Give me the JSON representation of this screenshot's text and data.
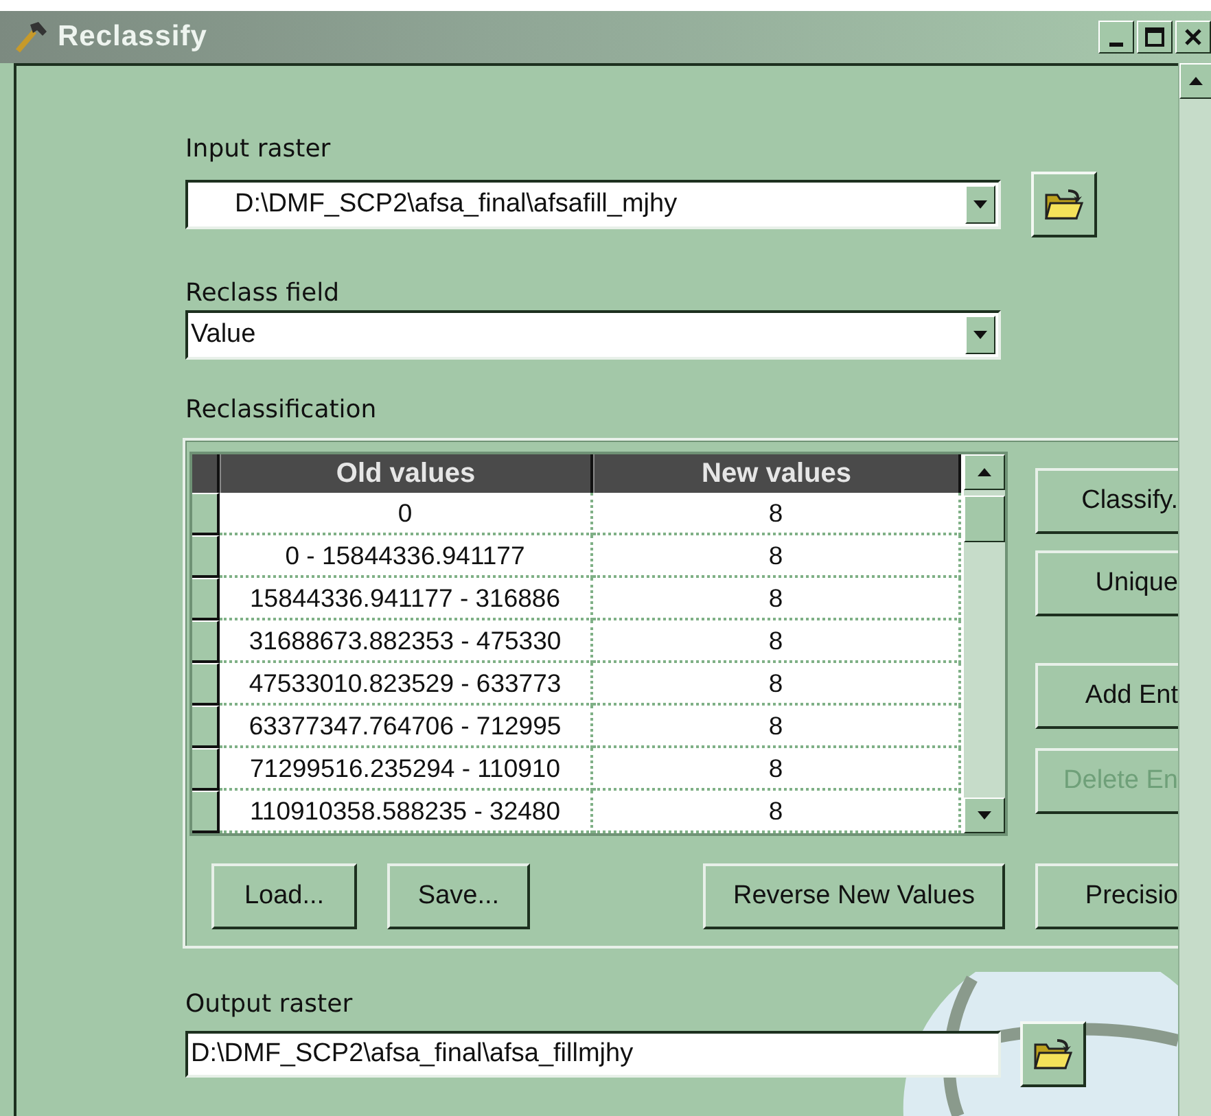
{
  "window": {
    "title": "Reclassify"
  },
  "input_raster": {
    "label": "Input raster",
    "value": "D:\\DMF_SCP2\\afsa_final\\afsafill_mjhy"
  },
  "reclass_field": {
    "label": "Reclass field",
    "value": "Value"
  },
  "reclassification": {
    "label": "Reclassification",
    "columns": [
      "Old values",
      "New values"
    ],
    "rows": [
      {
        "old": "0",
        "new": "8"
      },
      {
        "old": "0 - 15844336.941177",
        "new": "8"
      },
      {
        "old": "15844336.941177 - 316886",
        "new": "8"
      },
      {
        "old": "31688673.882353 - 475330",
        "new": "8"
      },
      {
        "old": "47533010.823529 - 633773",
        "new": "8"
      },
      {
        "old": "63377347.764706 - 712995",
        "new": "8"
      },
      {
        "old": "71299516.235294 - 110910",
        "new": "8"
      },
      {
        "old": "110910358.588235 - 32480",
        "new": "8"
      }
    ],
    "side_buttons": [
      {
        "label": "Classify.",
        "disabled": false
      },
      {
        "label": "Unique",
        "disabled": false
      },
      {
        "label": "Add Ent",
        "disabled": false
      },
      {
        "label": "Delete En",
        "disabled": true
      }
    ],
    "bottom_buttons": [
      {
        "label": "Load...",
        "disabled": false
      },
      {
        "label": "Save...",
        "disabled": false
      },
      {
        "label": "Reverse New Values",
        "disabled": false
      },
      {
        "label": "Precisio",
        "disabled": false
      }
    ]
  },
  "output_raster": {
    "label": "Output raster",
    "value": "D:\\DMF_SCP2\\afsa_final\\afsa_fillmjhy"
  }
}
